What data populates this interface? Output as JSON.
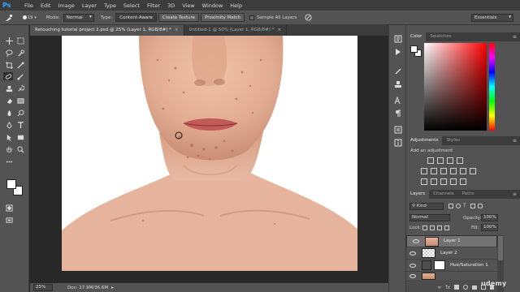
{
  "menubar": {
    "logo": "Ps",
    "items": [
      "File",
      "Edit",
      "Image",
      "Layer",
      "Type",
      "Select",
      "Filter",
      "3D",
      "View",
      "Window",
      "Help"
    ]
  },
  "options": {
    "brush_size": "19",
    "mode_label": "Mode:",
    "mode_value": "Normal",
    "type_label": "Type:",
    "type_buttons": [
      "Content-Aware",
      "Create Texture",
      "Proximity Match"
    ],
    "sample_all_label": "Sample All Layers",
    "workspace": "Essentials"
  },
  "tabs": [
    {
      "label": "Retouching tutorial project 2.psd @ 25% (Layer 1, RGB/8#) *",
      "active": true
    },
    {
      "label": "Untitled-1 @ 50% (Layer 1, RGB/8#) *",
      "active": false
    }
  ],
  "status": {
    "zoom": "25%",
    "doc": "Doc: 17.9M/36.6M"
  },
  "panels": {
    "color_tabs": [
      "Color",
      "Swatches"
    ],
    "adjustments_tabs": [
      "Adjustments",
      "Styles"
    ],
    "add_adjustment": "Add an adjustment",
    "layers_tabs": [
      "Layers",
      "Channels",
      "Paths"
    ],
    "kind_label": "Kind",
    "blend_mode": "Normal",
    "opacity_label": "Opacity:",
    "opacity": "100%",
    "lock_label": "Lock:",
    "fill_label": "Fill:",
    "fill": "100%",
    "layers": [
      {
        "name": "Layer 1",
        "selected": true
      },
      {
        "name": "Layer 2",
        "selected": false
      },
      {
        "name": "Hue/Saturation 1",
        "selected": false
      }
    ]
  },
  "watermark": "udemy"
}
